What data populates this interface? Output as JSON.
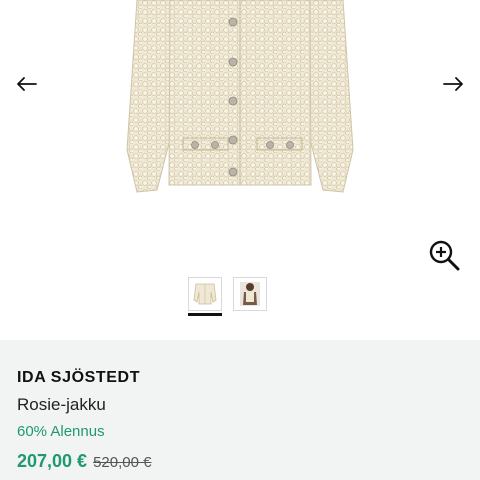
{
  "gallery": {
    "main_image": "cream-boucle-jacket",
    "prev_icon": "arrow-left-icon",
    "next_icon": "arrow-right-icon",
    "zoom_icon": "zoom-in-icon",
    "thumbnails": [
      {
        "name": "thumbnail-front",
        "active": true
      },
      {
        "name": "thumbnail-model",
        "active": false
      }
    ]
  },
  "product": {
    "brand": "IDA SJÖSTEDT",
    "name": "Rosie-jakku",
    "discount": "60% Alennus",
    "price": "207,00 €",
    "original_price": "520,00 €"
  },
  "colors": {
    "accent": "#1f9a6d",
    "panel_bg": "#f2f3f3",
    "text": "#111111"
  }
}
